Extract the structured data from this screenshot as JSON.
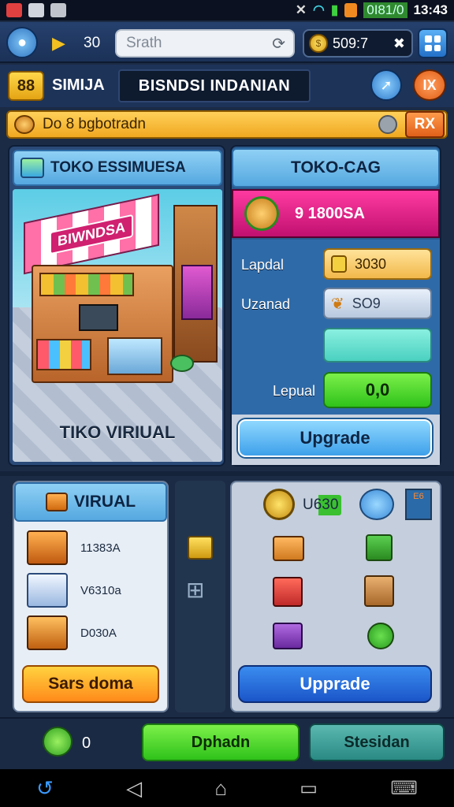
{
  "status": {
    "battery_text": "0I81/0",
    "time": "13:43"
  },
  "topbar": {
    "level": "30",
    "search_placeholder": "Srath",
    "coins": "509:7"
  },
  "header": {
    "level_badge": "88",
    "player_name": "SIMIJA",
    "title": "BISNDSI INDANIAN",
    "close_label": "IX"
  },
  "quest": {
    "text": "Do 8 bgbotradn",
    "reward_button": "RX"
  },
  "shop_panel": {
    "title": "TOKO ESSIMUESA",
    "awning_sign": "BIWNDSA",
    "footer": "TIKO VIRIUAL"
  },
  "stats_panel": {
    "title": "TOKO-CAG",
    "banner_value": "9 1800SA",
    "rows": [
      {
        "label": "Lapdal",
        "value": "3030"
      },
      {
        "label": "Uzanad",
        "value": "SO9"
      },
      {
        "label": "",
        "value": ""
      }
    ],
    "final_label": "Lepual",
    "final_value": "0,0",
    "upgrade_button": "Upgrade"
  },
  "virtual_panel": {
    "title": "VIRUAL",
    "items": [
      {
        "value": "11383A"
      },
      {
        "value": "V6310a"
      },
      {
        "value": "D030A"
      }
    ],
    "action_button": "Sars doma"
  },
  "upgrade_panel": {
    "coin_value": "U630",
    "badge": "E6",
    "button": "Upprade"
  },
  "bottom": {
    "count": "0",
    "green_button": "Dphadn",
    "teal_button": "Stesidan"
  },
  "colors": {
    "accent": "#2fc21a",
    "panel_blue": "#55a8e0",
    "background": "#1c2b45"
  }
}
